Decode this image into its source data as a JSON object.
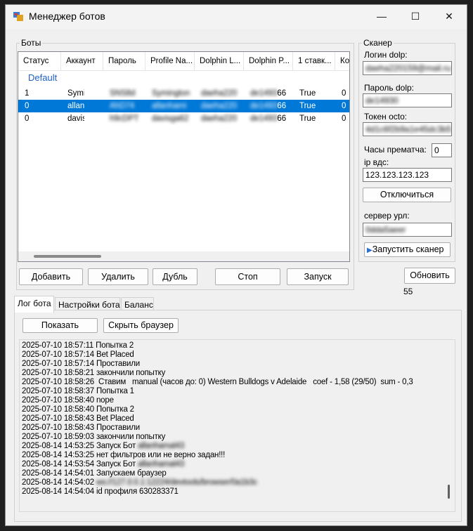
{
  "window": {
    "title": "Менеджер ботов",
    "icon": "bots-app-icon"
  },
  "bots_group": {
    "title": "Боты",
    "columns": [
      "Статус",
      "Аккаунт",
      "Пароль",
      "Profile Na...",
      "Dolphin L...",
      "Dolphin P...",
      "1 ставк...",
      "Ко"
    ],
    "group_label": "Default",
    "rows": [
      {
        "status": "1",
        "account": "Symingt",
        "password": "SNS8d",
        "profile": "Symington",
        "dolphin_login": "daeha220",
        "dolphin_pass": "de1493",
        "pass_suffix": "66",
        "first_bet": "True",
        "count": "0",
        "selected": false
      },
      {
        "status": "0",
        "account": "allanhu",
        "password": "AhD74",
        "profile": "allanhami",
        "dolphin_login": "daeha220",
        "dolphin_pass": "de1493",
        "pass_suffix": "66",
        "first_bet": "True",
        "count": "0",
        "selected": true
      },
      {
        "status": "0",
        "account": "davisgs",
        "password": "h9cDPT",
        "profile": "davisga62",
        "dolphin_login": "daeha220",
        "dolphin_pass": "de1493",
        "pass_suffix": "66",
        "first_bet": "True",
        "count": "0",
        "selected": false
      }
    ]
  },
  "bot_buttons": {
    "add": "Добавить",
    "delete": "Удалить",
    "duplicate": "Дубль",
    "stop": "Стоп",
    "start": "Запуск"
  },
  "scanner": {
    "title": "Сканер",
    "login_label": "Логин dolp:",
    "login_value": "daeha220159@mail.ru",
    "password_label": "Пароль dolp:",
    "password_value": "de14930",
    "token_label": "Токен octo:",
    "token_value": "4d1c6f2b9a1e45dc3b5",
    "prematch_label": "Часы прематча:",
    "prematch_value": "0",
    "ip_label": "ip вдс:",
    "ip_value": "123.123.123.123",
    "disconnect": "Отключиться",
    "server_label": "сервер урл:",
    "server_value": "0dda5aeer",
    "start_scanner": "Запустить сканер"
  },
  "refresh": {
    "label": "Обновить",
    "count": "55"
  },
  "tabs": [
    "Лог бота",
    "Настройки бота",
    "Баланс"
  ],
  "log_buttons": {
    "show": "Показать",
    "hide_browser": "Скрыть браузер"
  },
  "log": [
    {
      "text": "2025-07-10 18:57:11 Попытка 2"
    },
    {
      "text": "2025-07-10 18:57:14 Bet Placed"
    },
    {
      "text": "2025-07-10 18:57:14 Проставили"
    },
    {
      "text": "2025-07-10 18:58:21 закончили попытку"
    },
    {
      "text": "2025-07-10 18:58:26  Ставим   manual (часов до: 0) Western Bulldogs v Adelaide   coef - 1,58 (29/50)  sum - 0,3"
    },
    {
      "text": "2025-07-10 18:58:37 Попытка 1"
    },
    {
      "text": "2025-07-10 18:58:40 nope"
    },
    {
      "text": "2025-07-10 18:58:40 Попытка 2"
    },
    {
      "text": "2025-07-10 18:58:43 Bet Placed"
    },
    {
      "text": "2025-07-10 18:58:43 Проставили"
    },
    {
      "text": "2025-07-10 18:59:03 закончили попытку"
    },
    {
      "text": "2025-08-14 14:53:25 Запуск Бот ",
      "blurred": "allanhamal43"
    },
    {
      "text": "2025-08-14 14:53:25 нет фильтров или не верно задан!!!"
    },
    {
      "text": "2025-08-14 14:53:54 Запуск Бот ",
      "blurred": "allanhamal43"
    },
    {
      "text": "2025-08-14 14:54:01 Запускаем браузер"
    },
    {
      "text": "2025-08-14 14:54:02 ",
      "blurred": "ws://127.0.0.1:12224/devtools/browser/0a1b3c"
    },
    {
      "text": "2025-08-14 14:54:04 id профиля 630283371"
    }
  ]
}
